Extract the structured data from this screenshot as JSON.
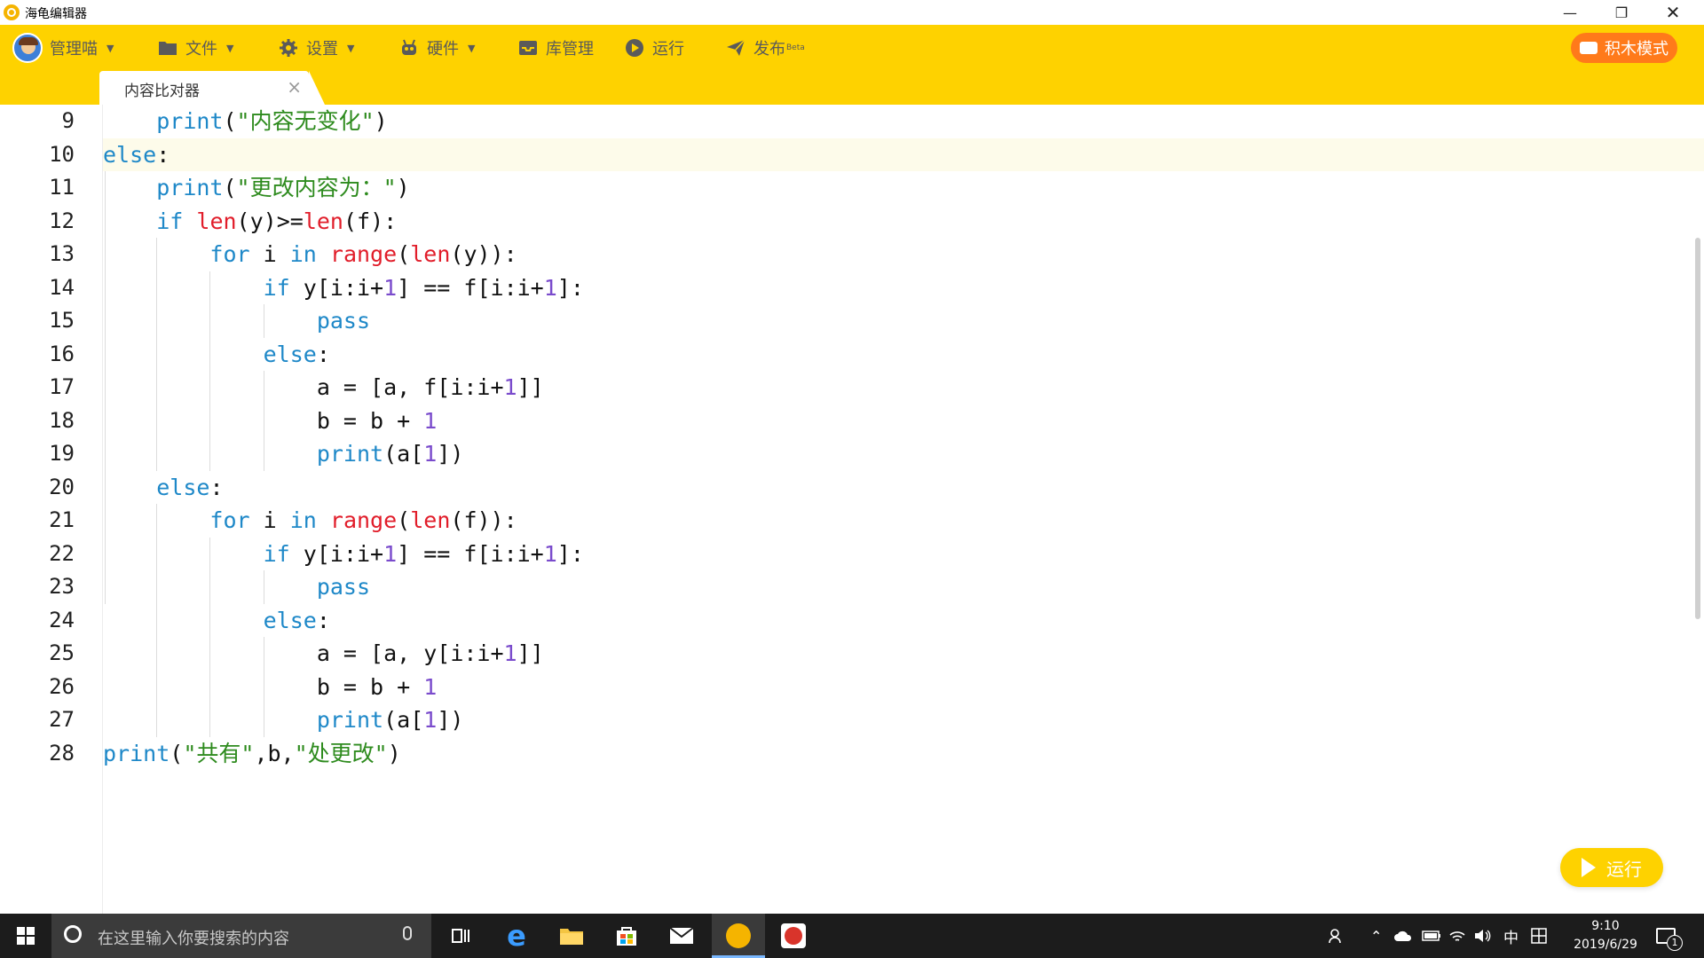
{
  "window": {
    "title": "海龟编辑器"
  },
  "toolbar": {
    "user_label": "管理喵",
    "file_label": "文件",
    "settings_label": "设置",
    "hardware_label": "硬件",
    "library_label": "库管理",
    "run_label": "运行",
    "publish_label": "发布",
    "publish_badge": "Beta",
    "mode_button_label": "积木模式",
    "accent_color": "#fed200",
    "mode_button_color": "#ff7a1a"
  },
  "tabs": [
    {
      "label": "内容比对器",
      "close_glyph": "×"
    }
  ],
  "editor": {
    "line_numbers": [
      "9",
      "10",
      "11",
      "12",
      "13",
      "14",
      "15",
      "16",
      "17",
      "18",
      "19",
      "20",
      "21",
      "22",
      "23",
      "24",
      "25",
      "26",
      "27",
      "28"
    ],
    "highlighted_line": "10",
    "language": "python",
    "run_button_label": "运行"
  },
  "taskbar": {
    "search_placeholder": "在这里输入你要搜索的内容",
    "ime_label": "中",
    "time": "9:10",
    "date": "2019/6/29",
    "notification_count": "1"
  }
}
